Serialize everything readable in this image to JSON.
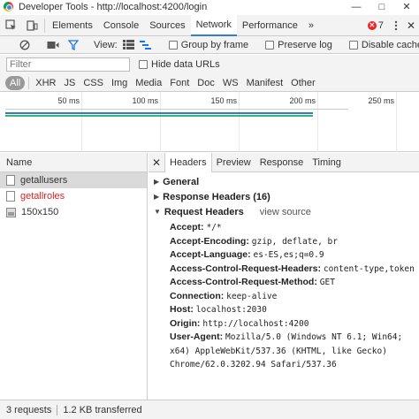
{
  "window": {
    "title": "Developer Tools - http://localhost:4200/login"
  },
  "tabs": [
    "Elements",
    "Console",
    "Sources",
    "Network",
    "Performance"
  ],
  "active_tab": "Network",
  "error_count": "7",
  "toolbar": {
    "view_label": "View:",
    "group_by_frame": "Group by frame",
    "preserve_log": "Preserve log",
    "disable_cache": "Disable cache"
  },
  "filter": {
    "placeholder": "Filter",
    "hide_data_urls": "Hide data URLs"
  },
  "types": [
    "All",
    "XHR",
    "JS",
    "CSS",
    "Img",
    "Media",
    "Font",
    "Doc",
    "WS",
    "Manifest",
    "Other"
  ],
  "timeline": {
    "ticks": [
      "50 ms",
      "100 ms",
      "150 ms",
      "200 ms",
      "250 ms"
    ]
  },
  "requests": {
    "column": "Name",
    "rows": [
      {
        "name": "getallusers"
      },
      {
        "name": "getallroles"
      },
      {
        "name": "150x150"
      }
    ]
  },
  "details": {
    "tabs": [
      "Headers",
      "Preview",
      "Response",
      "Timing"
    ],
    "sections": {
      "general": "General",
      "response_headers": "Response Headers (16)",
      "request_headers": "Request Headers",
      "view_source": "view source"
    },
    "request_headers": [
      {
        "key": "Accept:",
        "value": "*/*"
      },
      {
        "key": "Accept-Encoding:",
        "value": "gzip, deflate, br"
      },
      {
        "key": "Accept-Language:",
        "value": "es-ES,es;q=0.9"
      },
      {
        "key": "Access-Control-Request-Headers:",
        "value": "content-type,token"
      },
      {
        "key": "Access-Control-Request-Method:",
        "value": "GET"
      },
      {
        "key": "Connection:",
        "value": "keep-alive"
      },
      {
        "key": "Host:",
        "value": "localhost:2030"
      },
      {
        "key": "Origin:",
        "value": "http://localhost:4200"
      },
      {
        "key": "User-Agent:",
        "value": "Mozilla/5.0 (Windows NT 6.1; Win64; x64) AppleWebKit/537.36 (KHTML, like Gecko) Chrome/62.0.3202.94 Safari/537.36"
      }
    ]
  },
  "status": {
    "requests": "3 requests",
    "transferred": "1.2 KB transferred"
  },
  "colors": {
    "accent": "#3879d9",
    "record": "#ee1c1c",
    "error_text": "#e02020",
    "bar_blue": "#2a7fd4",
    "bar_green": "#3cb371"
  }
}
